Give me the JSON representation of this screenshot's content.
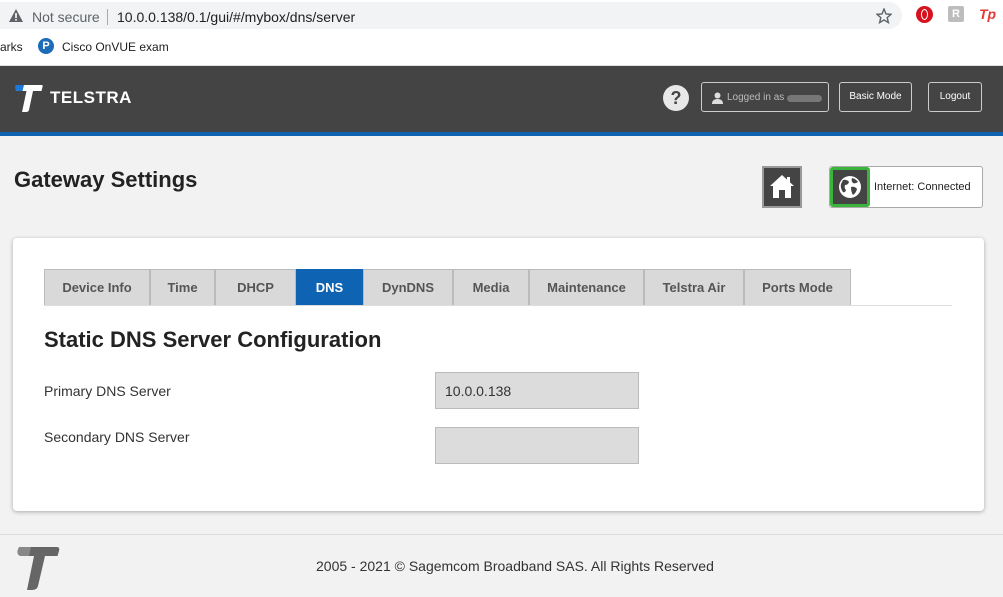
{
  "browser": {
    "security_label": "Not secure",
    "url": "10.0.0.138/0.1/gui/#/mybox/dns/server",
    "bookmarks": [
      {
        "label": "arks"
      },
      {
        "label": "Cisco OnVUE exam"
      }
    ],
    "extensions": {
      "r_label": "R",
      "tp_label": "Tp"
    }
  },
  "header": {
    "brand": "TELSTRA",
    "help_label": "?",
    "logged_in_label": "Logged in as",
    "basic_mode_label": "Basic Mode",
    "logout_label": "Logout"
  },
  "page": {
    "title": "Gateway Settings",
    "status_text": "Internet: Connected",
    "status_color": "#3cb33c"
  },
  "tabs": [
    {
      "label": "Device Info",
      "active": false
    },
    {
      "label": "Time",
      "active": false
    },
    {
      "label": "DHCP",
      "active": false
    },
    {
      "label": "DNS",
      "active": true
    },
    {
      "label": "DynDNS",
      "active": false
    },
    {
      "label": "Media",
      "active": false
    },
    {
      "label": "Maintenance",
      "active": false
    },
    {
      "label": "Telstra Air",
      "active": false
    },
    {
      "label": "Ports Mode",
      "active": false
    }
  ],
  "dns": {
    "section_title": "Static DNS Server Configuration",
    "primary_label": "Primary DNS Server",
    "primary_value": "10.0.0.138",
    "secondary_label": "Secondary DNS Server",
    "secondary_value": ""
  },
  "footer": {
    "copyright": "2005 - 2021 © Sagemcom Broadband SAS. All Rights Reserved"
  },
  "colors": {
    "accent_blue": "#0f63b3",
    "header_bg": "#444444"
  }
}
